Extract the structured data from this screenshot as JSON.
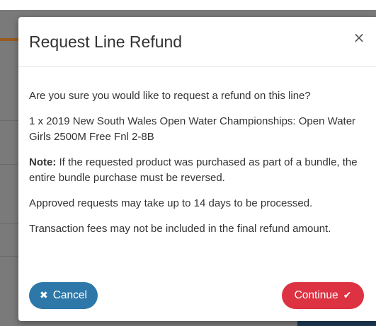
{
  "modal": {
    "title": "Request Line Refund",
    "close_glyph": "×",
    "question": "Are you sure you would like to request a refund on this line?",
    "line_item": "1 x 2019 New South Wales Open Water Championships: Open Water Girls 2500M Free Fnl 2-8B",
    "note_label": "Note:",
    "note_text": " If the requested product was purchased as part of a bundle, the entire bundle purchase must be reversed.",
    "processing_text": "Approved requests may take up to 14 days to be processed.",
    "fees_text": "Transaction fees may not be included in the final refund amount."
  },
  "buttons": {
    "cancel_label": "Cancel",
    "cancel_icon": "x-icon",
    "continue_label": "Continue",
    "continue_icon": "check-icon"
  },
  "colors": {
    "cancel_button": "#2d78a8",
    "continue_button": "#dc3242",
    "backdrop": "#7a7a7a"
  }
}
